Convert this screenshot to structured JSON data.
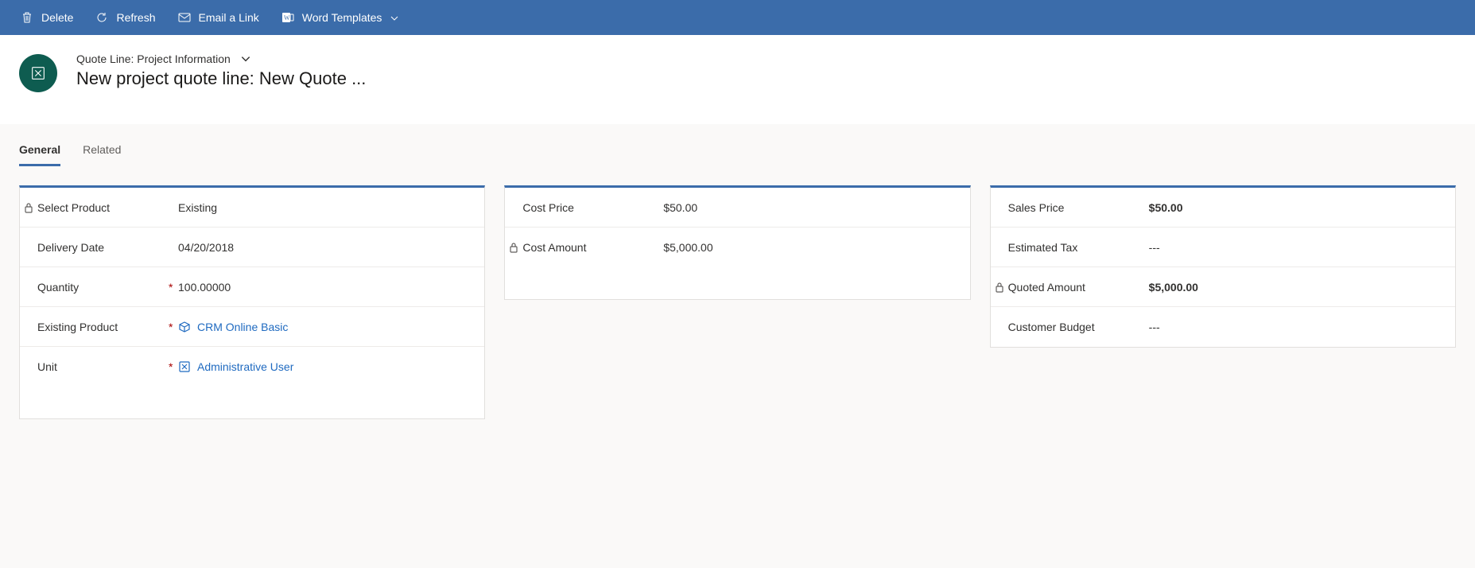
{
  "commandbar": {
    "delete": "Delete",
    "refresh": "Refresh",
    "email_link": "Email a Link",
    "word_templates": "Word Templates"
  },
  "header": {
    "form_label": "Quote Line: Project Information",
    "title": "New project quote line: New Quote ..."
  },
  "tabs": [
    {
      "label": "General",
      "active": true
    },
    {
      "label": "Related",
      "active": false
    }
  ],
  "cards": {
    "left": {
      "select_product_label": "Select Product",
      "select_product_value": "Existing",
      "delivery_date_label": "Delivery Date",
      "delivery_date_value": "04/20/2018",
      "quantity_label": "Quantity",
      "quantity_value": "100.00000",
      "existing_product_label": "Existing Product",
      "existing_product_value": "CRM Online Basic",
      "unit_label": "Unit",
      "unit_value": "Administrative User"
    },
    "middle": {
      "cost_price_label": "Cost Price",
      "cost_price_value": "$50.00",
      "cost_amount_label": "Cost Amount",
      "cost_amount_value": "$5,000.00"
    },
    "right": {
      "sales_price_label": "Sales Price",
      "sales_price_value": "$50.00",
      "estimated_tax_label": "Estimated Tax",
      "estimated_tax_value": "---",
      "quoted_amount_label": "Quoted Amount",
      "quoted_amount_value": "$5,000.00",
      "customer_budget_label": "Customer Budget",
      "customer_budget_value": "---"
    }
  }
}
